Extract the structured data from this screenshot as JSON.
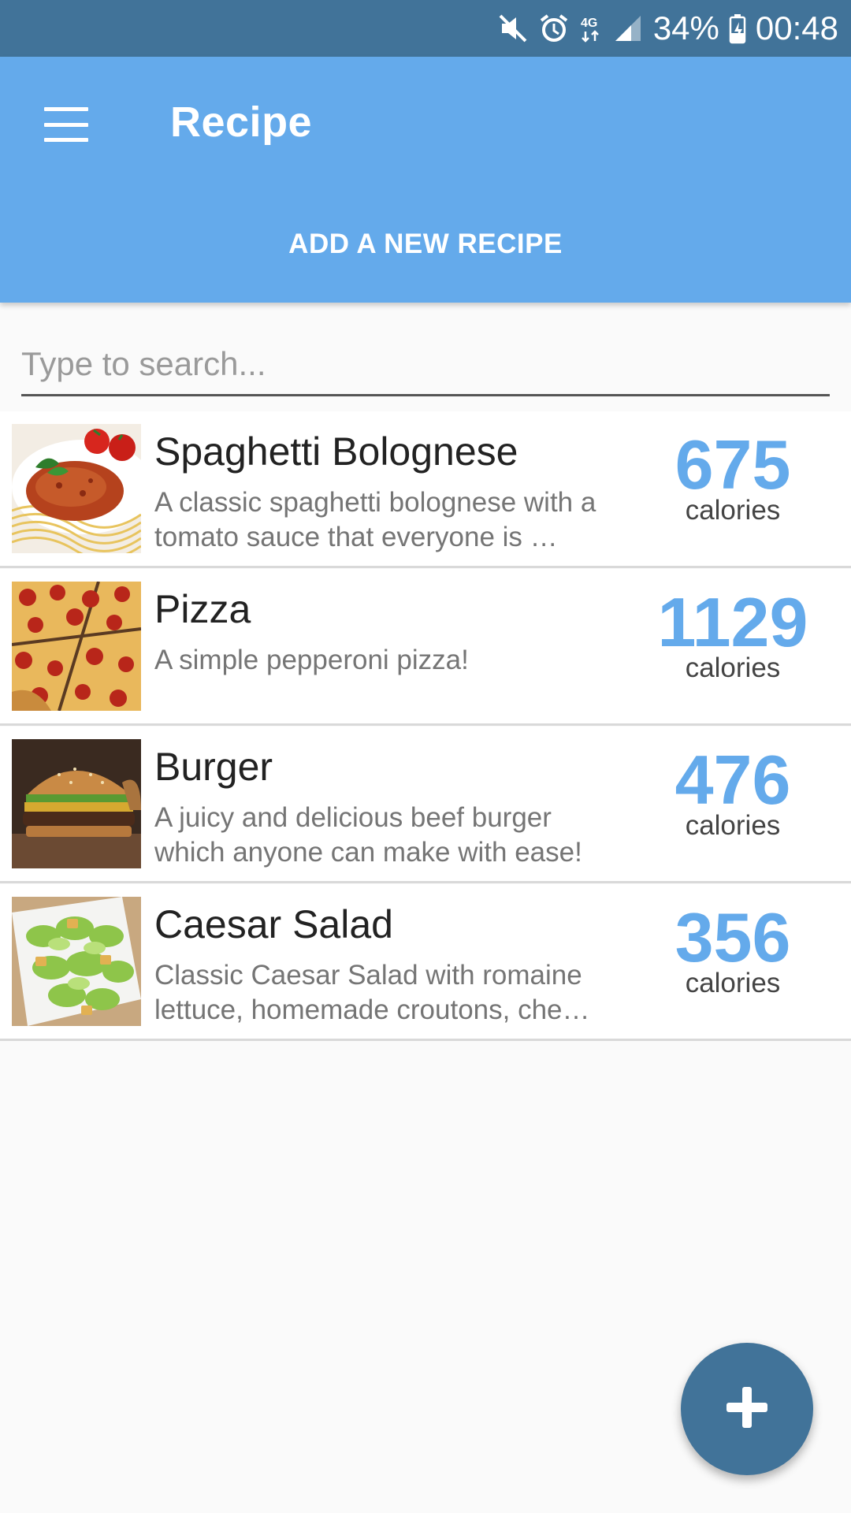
{
  "status_bar": {
    "battery": "34%",
    "time": "00:48",
    "network": "4G",
    "icons": [
      "mute-icon",
      "alarm-icon",
      "network-4g-icon",
      "signal-icon",
      "battery-icon"
    ]
  },
  "app_bar": {
    "title": "Recipe",
    "add_button_label": "ADD A NEW RECIPE",
    "menu_icon": "hamburger-menu-icon"
  },
  "search": {
    "placeholder": "Type to search...",
    "value": ""
  },
  "recipes": [
    {
      "name": "Spaghetti Bolognese",
      "description": "A classic spaghetti bolognese with a tomato sauce that everyone is …",
      "calories": "675",
      "calories_label": "calories",
      "image": "spaghetti-bolognese-photo"
    },
    {
      "name": "Pizza",
      "description": "A simple pepperoni pizza!",
      "calories": "1129",
      "calories_label": "calories",
      "image": "pepperoni-pizza-photo"
    },
    {
      "name": "Burger",
      "description": "A juicy and delicious beef burger which anyone can make with ease!",
      "calories": "476",
      "calories_label": "calories",
      "image": "beef-burger-photo"
    },
    {
      "name": "Caesar Salad",
      "description": "Classic Caesar Salad with romaine lettuce, homemade croutons, che…",
      "calories": "356",
      "calories_label": "calories",
      "image": "caesar-salad-photo"
    }
  ],
  "fab": {
    "icon": "plus-icon"
  },
  "colors": {
    "status_bar": "#417399",
    "app_bar": "#64aaeb",
    "accent": "#64aaeb",
    "fab": "#417399"
  }
}
